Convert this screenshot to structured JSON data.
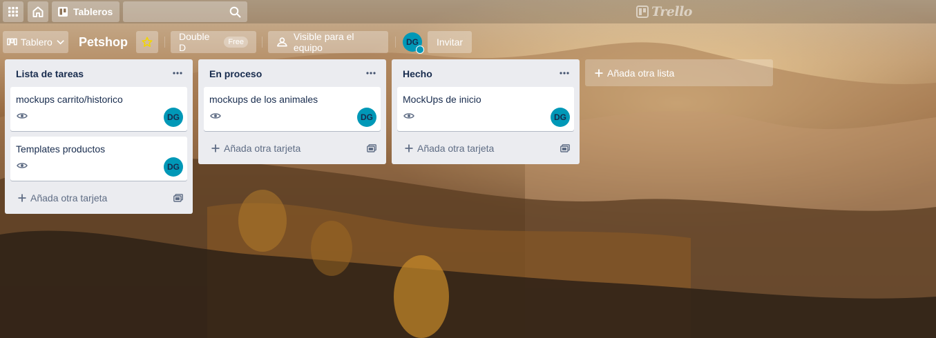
{
  "topbar": {
    "boards_label": "Tableros",
    "search_value": "",
    "logo_text": "Trello"
  },
  "board_header": {
    "view_label": "Tablero",
    "title": "Petshop",
    "team_name": "Double D",
    "team_plan": "Free",
    "visibility_label": "Visible para el equipo",
    "member_initials": "DG",
    "invite_label": "Invitar"
  },
  "colors": {
    "avatar": "#0098b7",
    "list_bg": "#ebecf0",
    "star": "#f2d600"
  },
  "icons": {
    "apps": "apps-grid-icon",
    "home": "home-icon",
    "boards": "board-icon",
    "search": "search-icon",
    "view": "board-view-icon",
    "dropdown": "chevron-down-icon",
    "star": "star-icon",
    "visibility": "team-visibility-icon",
    "menu": "ellipsis-icon",
    "watch": "eye-icon",
    "add": "plus-icon",
    "template": "card-template-icon"
  },
  "lists": [
    {
      "title": "Lista de tareas",
      "cards": [
        {
          "title": "mockups carrito/historico",
          "member": "DG"
        },
        {
          "title": "Templates productos",
          "member": "DG"
        }
      ],
      "add_card_label": "Añada otra tarjeta"
    },
    {
      "title": "En proceso",
      "cards": [
        {
          "title": "mockups de los animales",
          "member": "DG"
        }
      ],
      "add_card_label": "Añada otra tarjeta"
    },
    {
      "title": "Hecho",
      "cards": [
        {
          "title": "MockUps de inicio",
          "member": "DG"
        }
      ],
      "add_card_label": "Añada otra tarjeta"
    }
  ],
  "add_list_label": "Añada otra lista"
}
